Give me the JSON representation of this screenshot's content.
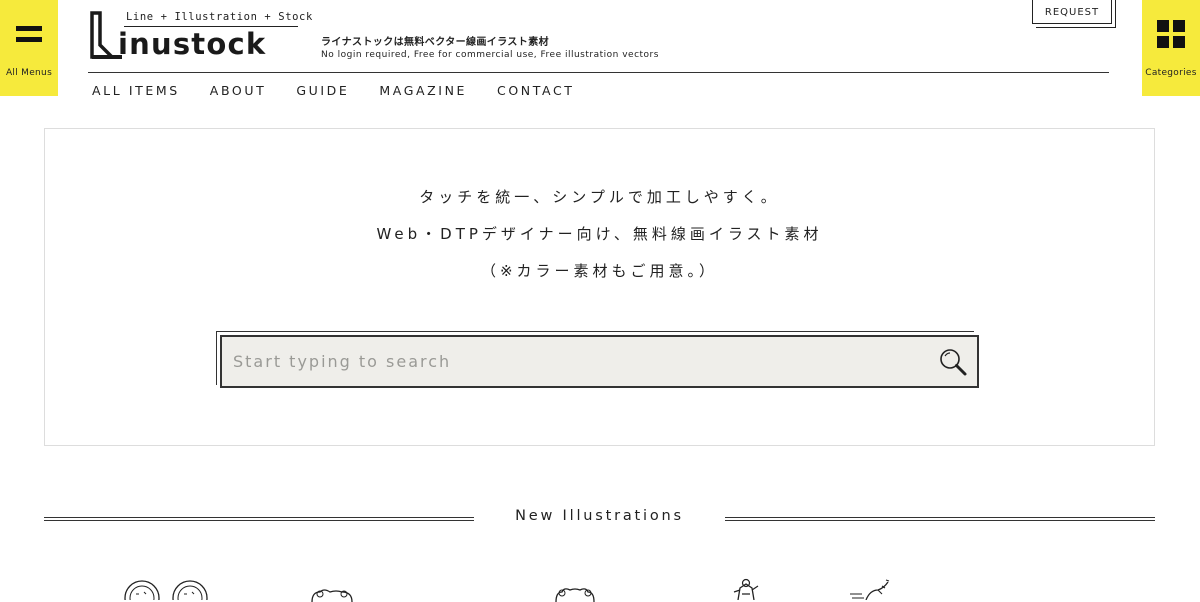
{
  "menus": {
    "all_menus_label": "All Menus",
    "categories_label": "Categories",
    "all_menus_icon": "hamburger-icon",
    "categories_icon": "grid-icon"
  },
  "logo": {
    "tagline": "Line + Illustration + Stock",
    "brand": "inustock",
    "sub_jp": "ライナストックは無料ベクター線画イラスト素材",
    "sub_en": "No login required, Free for commercial use, Free illustration vectors"
  },
  "request_label": "REQUEST",
  "nav": [
    {
      "label": "ALL ITEMS"
    },
    {
      "label": "ABOUT"
    },
    {
      "label": "GUIDE"
    },
    {
      "label": "MAGAZINE"
    },
    {
      "label": "CONTACT"
    }
  ],
  "hero": {
    "line1": "タッチを統一、シンプルで加工しやすく。",
    "line2": "Web・DTPデザイナー向け、無料線画イラスト素材",
    "line3": "（※カラー素材もご用意。）"
  },
  "search": {
    "placeholder": "Start typing to search",
    "value": "",
    "icon": "search-icon"
  },
  "section": {
    "title": "New Illustrations"
  },
  "colors": {
    "accent_yellow": "#f6ea3c",
    "search_bg": "#efeeea",
    "text": "#222222",
    "border": "#dddddd"
  }
}
